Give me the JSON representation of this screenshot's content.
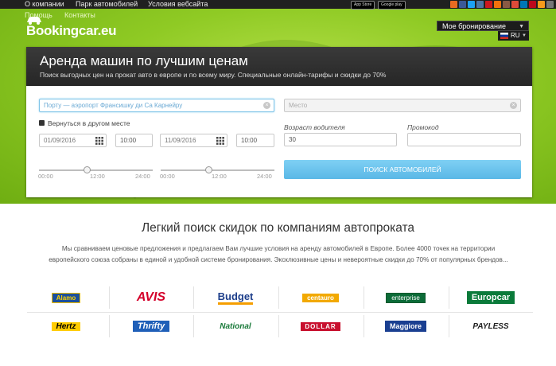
{
  "nav": {
    "items": [
      "О компании",
      "Парк автомобилей",
      "Условия вебсайта"
    ],
    "sub_items": [
      "Помощь",
      "Контакты"
    ],
    "app_store": "App Store",
    "google_play": "Google play"
  },
  "logo": "Bookingcar.eu",
  "booking_select": "Мое бронирование",
  "language": "RU",
  "social_icons": [
    "blog-icon",
    "facebook-icon",
    "twitter-icon",
    "vk-icon",
    "youtube-icon",
    "odnoklassniki-icon",
    "instagram-icon",
    "googleplus-icon",
    "linkedin-icon",
    "pinterest-icon",
    "rss-icon",
    "mail-icon"
  ],
  "panel": {
    "title": "Аренда машин по лучшим ценам",
    "subtitle": "Поиск выгодных цен на прокат авто в европе и по всему миру. Специальные онлайн-тарифы и скидки до 70%",
    "pickup_value": "Порту — аэропорт Франсишку ди Са Карнейру",
    "place_placeholder": "Место",
    "return_other": "Вернуться в другом месте",
    "pickup_date": "01/09/2016",
    "pickup_time": "10:00",
    "return_date": "11/09/2016",
    "return_time": "10:00",
    "driver_age_label": "Возраст водителя",
    "driver_age": "30",
    "promo_label": "Промокод",
    "promo_value": "",
    "slider_ticks": [
      "00:00",
      "12:00",
      "24:00"
    ],
    "pickup_slider_level": 0.42,
    "return_slider_level": 0.42,
    "search_button": "ПОИСК АВТОМОБИЛЕЙ"
  },
  "headline": "Легкий поиск скидок по компаниям автопроката",
  "intro": "Мы сравниваем ценовые предложения и предлагаем Вам лучшие условия на аренду автомобилей в Европе. Более 4000 точек на территории европейского союза собраны в единой и удобной системе бронирования. Эксклюзивные цены и невероятные скидки до 70% от популярных брендов...",
  "brands_row1": [
    "Alamo",
    "AVIS",
    "Budget",
    "centauro",
    "enterprise",
    "Europcar"
  ],
  "brands_row2": [
    "Hertz",
    "Thrifty",
    "National",
    "DOLLAR",
    "Maggiore",
    "PAYLESS"
  ],
  "colors": {
    "hero_green": "#8fca24",
    "panel_dark": "#2c2c2c",
    "button_blue": "#5ab8e6"
  }
}
